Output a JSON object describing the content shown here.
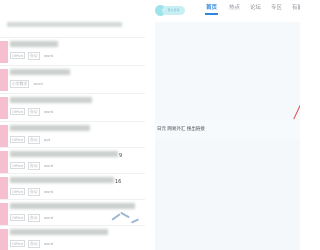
{
  "header": {
    "logo_text": "育人分享",
    "nav": [
      "首页",
      "热点",
      "论坛",
      "专区",
      "有能"
    ],
    "active_index": 0
  },
  "list": {
    "rows": [
      {
        "meta": [
          "Office",
          "办公"
        ],
        "tail": ""
      },
      {
        "meta": [
          "小学数学",
          "word"
        ],
        "tail": ""
      },
      {
        "meta": [
          "Office",
          "办公"
        ],
        "tail": ""
      },
      {
        "meta": [
          "Office",
          "办公"
        ],
        "tail": ""
      },
      {
        "meta": [
          "Office",
          "办公"
        ],
        "tail": "9"
      },
      {
        "meta": [
          "Office",
          "办公"
        ],
        "tail": "16"
      },
      {
        "meta": [
          "Office",
          "办公"
        ],
        "tail": ""
      },
      {
        "meta": [
          "Office",
          "办公"
        ],
        "tail": ""
      }
    ],
    "row_labels": [
      "word",
      "word",
      "word",
      "ppt",
      "word",
      "word",
      "word",
      "word"
    ]
  },
  "right_panel": {
    "caption": "日元 网易外汇 搜出链接"
  },
  "colors": {
    "accent": "#2e86de",
    "thumb": "#f5bfd0",
    "teal": "#9ee3ea"
  }
}
